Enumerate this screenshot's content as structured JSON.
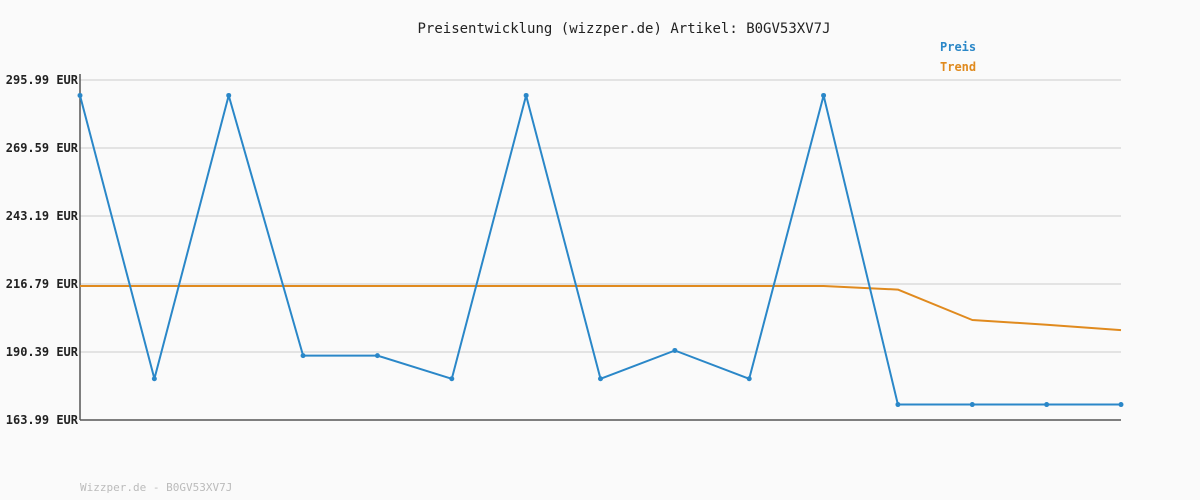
{
  "chart_data": {
    "type": "line",
    "title": "Preisentwicklung (wizzper.de) Artikel: B0GV53XV7J",
    "xlabel": "",
    "ylabel": "",
    "ylim": [
      163.99,
      295.99
    ],
    "y_ticks": [
      "295.99 EUR",
      "269.59 EUR",
      "243.19 EUR",
      "216.79 EUR",
      "190.39 EUR",
      "163.99 EUR"
    ],
    "y_tick_values": [
      295.99,
      269.59,
      243.19,
      216.79,
      190.39,
      163.99
    ],
    "x": [
      0,
      1,
      2,
      3,
      4,
      5,
      6,
      7,
      8,
      9,
      10,
      11,
      12,
      13,
      14
    ],
    "grid": true,
    "legend_position": "top-right",
    "series": [
      {
        "name": "Preis",
        "color": "#2a87c8",
        "values": [
          289.99,
          179.99,
          289.99,
          188.99,
          188.99,
          179.99,
          289.99,
          179.99,
          190.99,
          179.99,
          289.99,
          169.99,
          169.99,
          169.99,
          169.99
        ]
      },
      {
        "name": "Trend",
        "color": "#e08a1e",
        "values": [
          216.0,
          216.0,
          216.0,
          216.0,
          216.0,
          216.0,
          216.0,
          216.0,
          216.0,
          216.0,
          216.0,
          214.6,
          202.8,
          201.0,
          198.9
        ]
      }
    ]
  },
  "footer_text": "Wizzper.de - B0GV53XV7J",
  "colors": {
    "grid": "#e3e3e3",
    "axis": "#555555",
    "background": "#fafafa"
  }
}
